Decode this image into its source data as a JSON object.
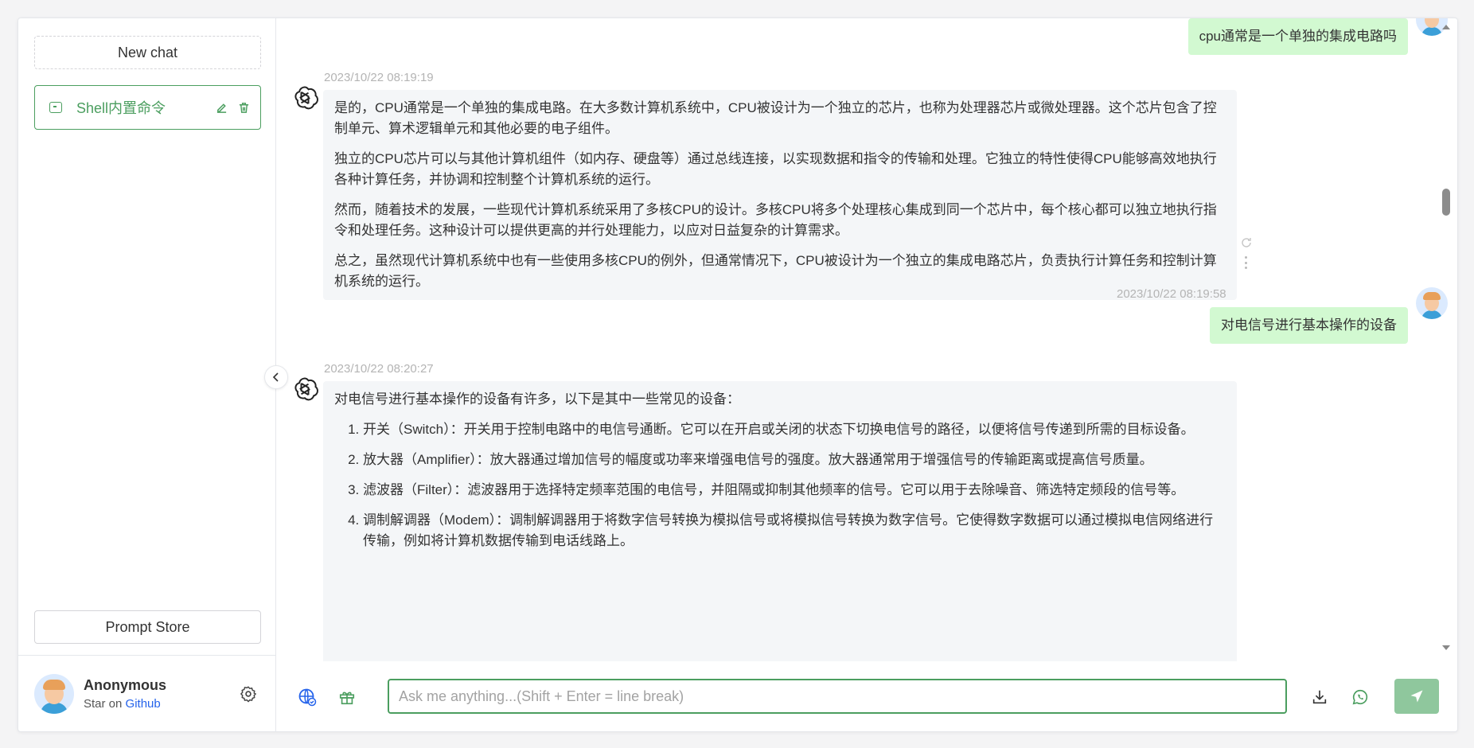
{
  "sidebar": {
    "new_chat_label": "New chat",
    "history": [
      {
        "title": "Shell内置命令",
        "active": true
      }
    ],
    "prompt_store_label": "Prompt Store",
    "user": {
      "name": "Anonymous",
      "sub_prefix": "Star on ",
      "sub_link": "Github"
    }
  },
  "messages": {
    "user_1": {
      "text": "cpu通常是一个单独的集成电路吗"
    },
    "bot_1": {
      "timestamp": "2023/10/22 08:19:19",
      "paragraphs": [
        "是的，CPU通常是一个单独的集成电路。在大多数计算机系统中，CPU被设计为一个独立的芯片，也称为处理器芯片或微处理器。这个芯片包含了控制单元、算术逻辑单元和其他必要的电子组件。",
        "独立的CPU芯片可以与其他计算机组件（如内存、硬盘等）通过总线连接，以实现数据和指令的传输和处理。它独立的特性使得CPU能够高效地执行各种计算任务，并协调和控制整个计算机系统的运行。",
        "然而，随着技术的发展，一些现代计算机系统采用了多核CPU的设计。多核CPU将多个处理核心集成到同一个芯片中，每个核心都可以独立地执行指令和处理任务。这种设计可以提供更高的并行处理能力，以应对日益复杂的计算需求。",
        "总之，虽然现代计算机系统中也有一些使用多核CPU的例外，但通常情况下，CPU被设计为一个独立的集成电路芯片，负责执行计算任务和控制计算机系统的运行。"
      ]
    },
    "user_2": {
      "timestamp": "2023/10/22 08:19:58",
      "text": "对电信号进行基本操作的设备"
    },
    "bot_2": {
      "timestamp": "2023/10/22 08:20:27",
      "intro": "对电信号进行基本操作的设备有许多，以下是其中一些常见的设备：",
      "items": [
        "开关（Switch）：开关用于控制电路中的电信号通断。它可以在开启或关闭的状态下切换电信号的路径，以便将信号传递到所需的目标设备。",
        "放大器（Amplifier）：放大器通过增加信号的幅度或功率来增强电信号的强度。放大器通常用于增强信号的传输距离或提高信号质量。",
        "滤波器（Filter）：滤波器用于选择特定频率范围的电信号，并阻隔或抑制其他频率的信号。它可以用于去除噪音、筛选特定频段的信号等。",
        "调制解调器（Modem）：调制解调器用于将数字信号转换为模拟信号或将模拟信号转换为数字信号。它使得数字数据可以通过模拟电信网络进行传输，例如将计算机数据传输到电话线路上。"
      ]
    }
  },
  "input": {
    "placeholder": "Ask me anything...(Shift + Enter = line break)",
    "value": ""
  },
  "colors": {
    "accent": "#4b9e5f",
    "user_bubble": "#d2f9d1",
    "bot_bubble": "#f4f6f8",
    "send_button": "#8fc79d"
  }
}
